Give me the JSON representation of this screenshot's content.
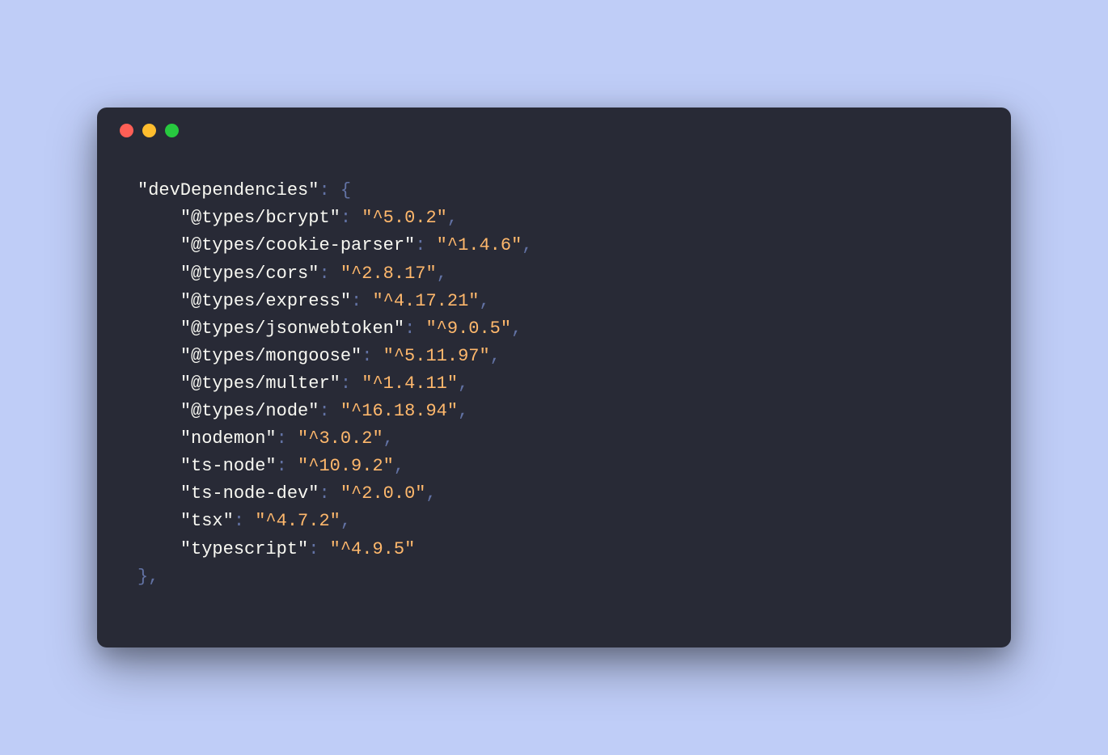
{
  "sectionKey": "devDependencies",
  "entries": [
    {
      "key": "@types/bcrypt",
      "value": "^5.0.2"
    },
    {
      "key": "@types/cookie-parser",
      "value": "^1.4.6"
    },
    {
      "key": "@types/cors",
      "value": "^2.8.17"
    },
    {
      "key": "@types/express",
      "value": "^4.17.21"
    },
    {
      "key": "@types/jsonwebtoken",
      "value": "^9.0.5"
    },
    {
      "key": "@types/mongoose",
      "value": "^5.11.97"
    },
    {
      "key": "@types/multer",
      "value": "^1.4.11"
    },
    {
      "key": "@types/node",
      "value": "^16.18.94"
    },
    {
      "key": "nodemon",
      "value": "^3.0.2"
    },
    {
      "key": "ts-node",
      "value": "^10.9.2"
    },
    {
      "key": "ts-node-dev",
      "value": "^2.0.0"
    },
    {
      "key": "tsx",
      "value": "^4.7.2"
    },
    {
      "key": "typescript",
      "value": "^4.9.5"
    }
  ],
  "colors": {
    "background": "#bfcdf7",
    "windowBg": "#282a36",
    "key": "#f8f8f2",
    "string": "#ffb86c",
    "punct": "#6272a4",
    "dotRed": "#ff5f56",
    "dotYellow": "#ffbd2e",
    "dotGreen": "#27c93f"
  }
}
